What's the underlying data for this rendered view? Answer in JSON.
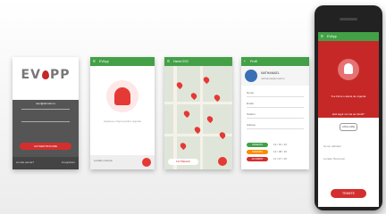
{
  "colors": {
    "red": "#d32f2f",
    "green": "#43a047",
    "dark": "#555555"
  },
  "screen1": {
    "logo": "EV",
    "logo_tail": "PP",
    "email": "user@domain.ro",
    "button": "AUTHENTIFICARE",
    "footer_left": "Ai uitat parola?",
    "footer_right": "Inregistrare"
  },
  "screen2": {
    "header_title": "EVApp",
    "caption": "Apasa pe clopot pentru urgenta",
    "footer_text": "Locatie curenta"
  },
  "screen3": {
    "header_title": "Harta OSC",
    "chip": "FILTREAZA"
  },
  "screen4": {
    "header_title": "Profil",
    "name": "NATHANAEL",
    "sub": "nathanael@email.ro",
    "rows": [
      "Nume",
      "Email",
      "Telefon",
      "Adresa"
    ],
    "pills": [
      "URGENTA",
      "INCENDIU",
      "ACCIDENT"
    ],
    "pill_vals": [
      "12 / 10 / 16",
      "12 / 08 / 16",
      "11 / 07 / 16"
    ]
  },
  "phone": {
    "header_title": "EVApp",
    "red_text": "S-a trimis o alerta de urgenta",
    "red_sub": "Esti sigur ca vrei sa trimiti?",
    "ok": "ANULARE",
    "info1": "Nume utilizator",
    "info2": "Locatie: Bucuresti",
    "send": "TRIMITE"
  }
}
